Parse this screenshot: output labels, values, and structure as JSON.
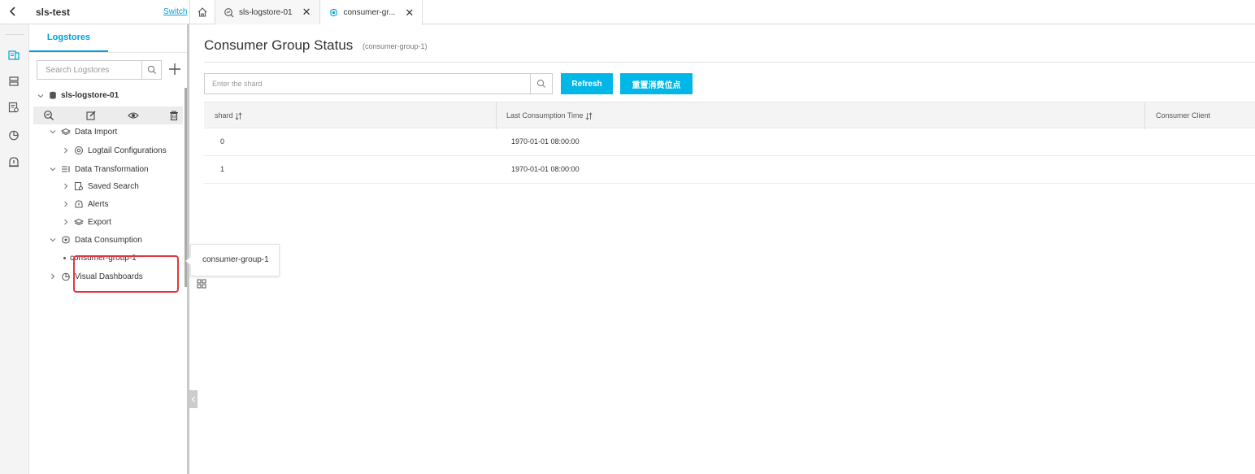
{
  "header": {
    "project_name": "sls-test",
    "switch_label": "Switch"
  },
  "tabs": [
    {
      "label": "sls-logstore-01",
      "icon": "search-chart-icon"
    },
    {
      "label": "consumer-gr...",
      "icon": "consumer-icon",
      "active": true
    }
  ],
  "panel": {
    "tab_label": "Logstores",
    "search_placeholder": "Search Logstores",
    "logstore_name": "sls-logstore-01",
    "tree": {
      "data_import": "Data Import",
      "logtail_configurations": "Logtail Configurations",
      "data_transformation": "Data Transformation",
      "saved_search": "Saved Search",
      "alerts": "Alerts",
      "export": "Export",
      "data_consumption": "Data Consumption",
      "consumer_group": "consumer-group-1",
      "visual_dashboards": "Visual Dashboards"
    }
  },
  "tooltip": {
    "text": "consumer-group-1"
  },
  "main": {
    "title": "Consumer Group Status",
    "subtitle": "(consumer-group-1)",
    "shard_placeholder": "Enter the shard",
    "refresh_label": "Refresh",
    "reset_label": "重置消费位点",
    "columns": [
      "shard",
      "Last Consumption Time",
      "Consumer Client"
    ],
    "rows": [
      {
        "shard": "0",
        "time": "1970-01-01 08:00:00",
        "client": ""
      },
      {
        "shard": "1",
        "time": "1970-01-01 08:00:00",
        "client": ""
      }
    ]
  },
  "colors": {
    "accent": "#00a1d6",
    "button": "#00b7e8",
    "highlight": "#e0383e"
  }
}
